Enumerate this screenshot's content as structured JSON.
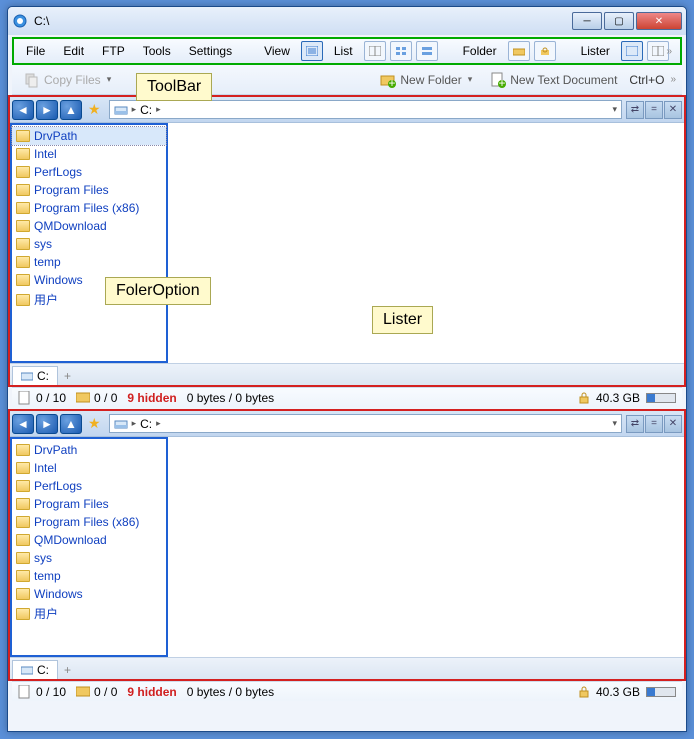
{
  "window": {
    "title": "C:\\"
  },
  "menubar": {
    "items": [
      "File",
      "Edit",
      "FTP",
      "Tools",
      "Settings",
      "View"
    ],
    "list_label": "List",
    "folder_label": "Folder",
    "lister_label": "Lister"
  },
  "toolbar": {
    "copy_label": "Copy Files",
    "new_folder_label": "New Folder",
    "new_text_label": "New Text Document",
    "shortcut": "Ctrl+O"
  },
  "annotations": {
    "toolbar": "ToolBar",
    "folder_option": "FolerOption",
    "lister": "Lister"
  },
  "path": {
    "drive": "C:"
  },
  "folders": [
    "DrvPath",
    "Intel",
    "PerfLogs",
    "Program Files",
    "Program Files (x86)",
    "QMDownload",
    "sys",
    "temp",
    "Windows",
    "用户"
  ],
  "tab": {
    "label": "C:"
  },
  "status": {
    "sel_files": "0 / 10",
    "sel_folders": "0 / 0",
    "hidden": "9 hidden",
    "bytes": "0 bytes / 0 bytes",
    "disk_free": "40.3 GB"
  }
}
